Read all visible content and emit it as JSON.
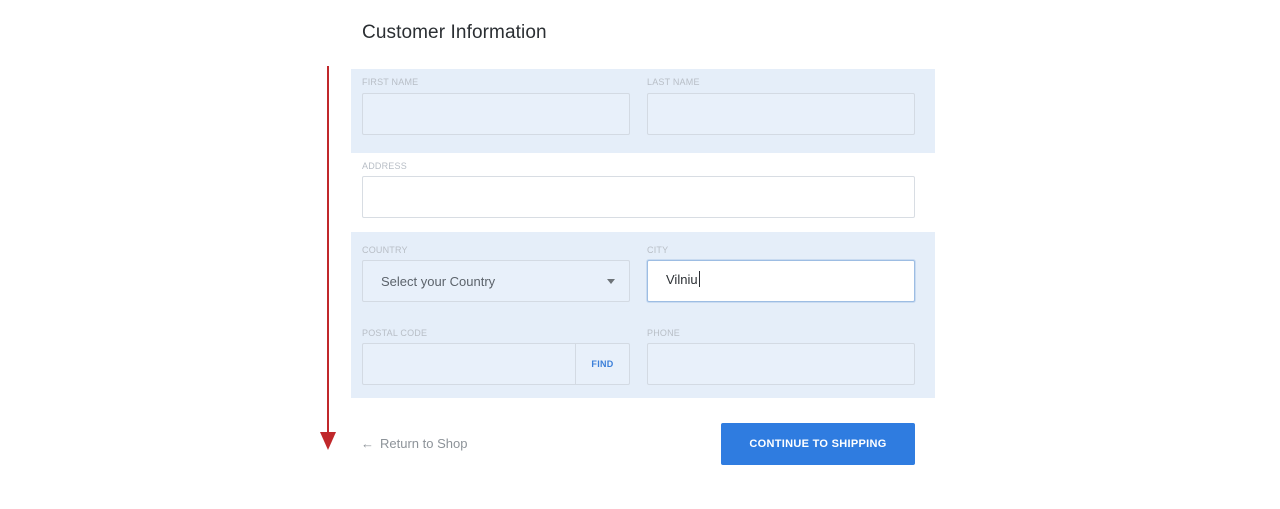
{
  "page": {
    "title": "Customer Information"
  },
  "form": {
    "first_name": {
      "label": "FIRST NAME",
      "value": "",
      "placeholder": ""
    },
    "last_name": {
      "label": "LAST NAME",
      "value": "",
      "placeholder": ""
    },
    "address": {
      "label": "ADDRESS",
      "value": "",
      "placeholder": ""
    },
    "country": {
      "label": "COUNTRY",
      "selected": "Select your Country"
    },
    "city": {
      "label": "CITY",
      "value": "Vilniu"
    },
    "postal_code": {
      "label": "POSTAL CODE",
      "value": "",
      "find_label": "FIND"
    },
    "phone": {
      "label": "PHONE",
      "value": "",
      "placeholder": ""
    }
  },
  "actions": {
    "return_label": "Return to Shop",
    "continue_label": "CONTINUE TO SHIPPING"
  },
  "icons": {
    "return": "arrow-left-icon",
    "country_dropdown": "caret-down-icon",
    "scroll": "arrow-down-icon"
  },
  "colors": {
    "accent": "#2f7ce0",
    "field_band": "#e5eef9",
    "scroll_indicator": "#c0282b"
  }
}
